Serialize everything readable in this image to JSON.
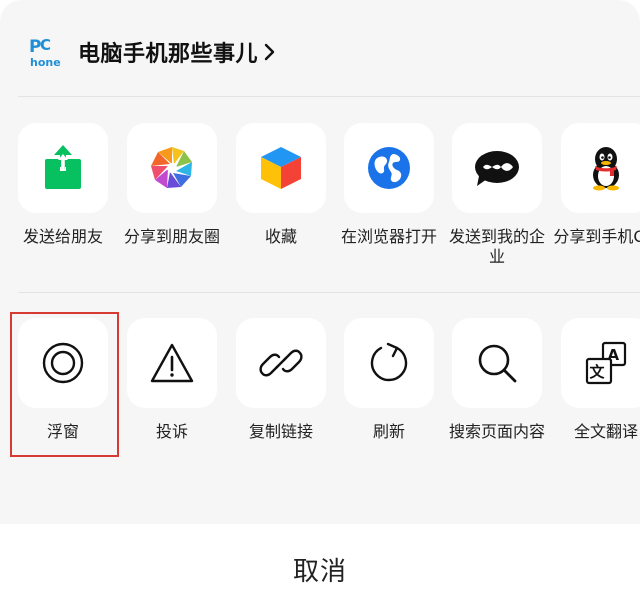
{
  "header": {
    "logo_text": "PC hone",
    "title": "电脑手机那些事儿"
  },
  "row1": [
    {
      "label": "发送给朋友",
      "icon": "share-upload-icon"
    },
    {
      "label": "分享到朋友圈",
      "icon": "moments-aperture-icon"
    },
    {
      "label": "收藏",
      "icon": "favorites-cube-icon"
    },
    {
      "label": "在浏览器打开",
      "icon": "browser-globe-icon"
    },
    {
      "label": "发送到我的企业",
      "icon": "wecom-icon"
    },
    {
      "label": "分享到手机QQ",
      "icon": "qq-penguin-icon"
    }
  ],
  "row2": [
    {
      "label": "浮窗",
      "icon": "floating-window-icon"
    },
    {
      "label": "投诉",
      "icon": "warning-triangle-icon"
    },
    {
      "label": "复制链接",
      "icon": "link-icon"
    },
    {
      "label": "刷新",
      "icon": "refresh-icon"
    },
    {
      "label": "搜索页面内容",
      "icon": "search-icon"
    },
    {
      "label": "全文翻译",
      "icon": "translate-icon"
    }
  ],
  "cancel_label": "取消",
  "colors": {
    "sheet_bg": "#f6f6f6",
    "tile_bg": "#ffffff",
    "highlight_border": "#d63a32",
    "green": "#07c160",
    "blue": "#1a73e8"
  }
}
